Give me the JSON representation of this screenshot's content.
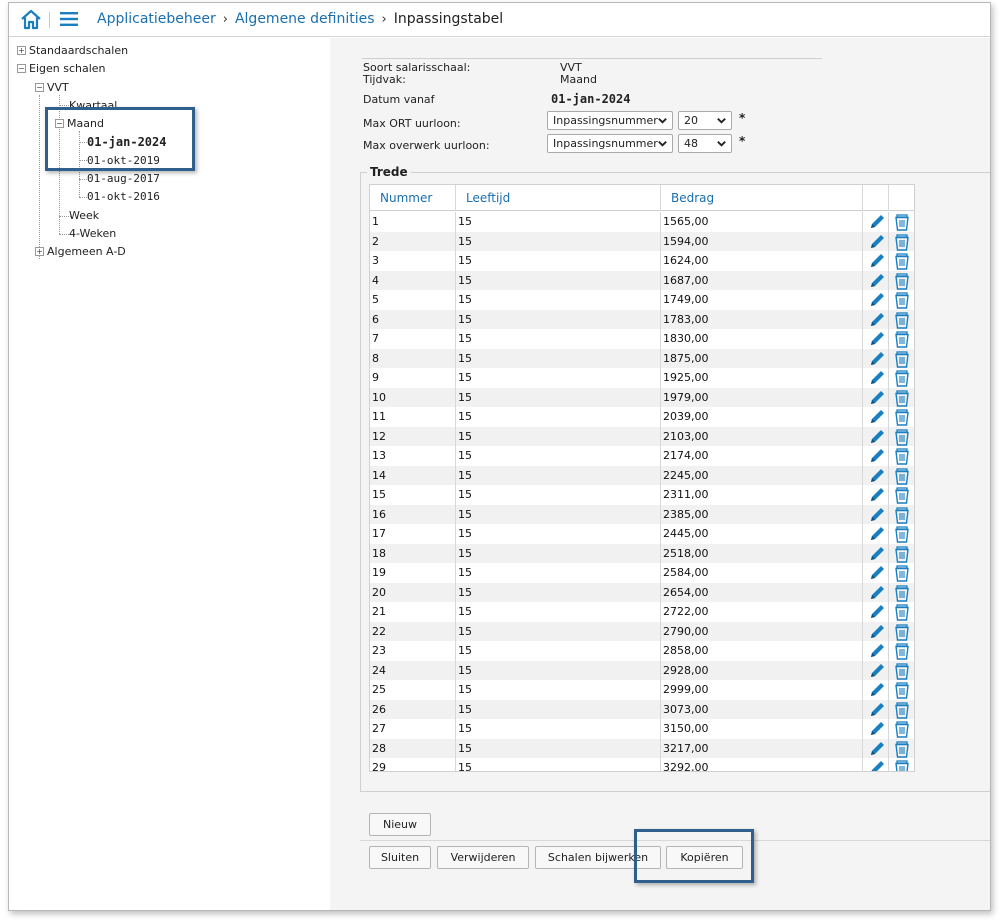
{
  "topbar": {
    "home_icon": "home-icon",
    "menu_icon": "hamburger-menu-icon",
    "breadcrumb": [
      {
        "label": "Applicatiebeheer",
        "link": true
      },
      {
        "label": "Algemene definities",
        "link": true
      },
      {
        "label": "Inpassingstabel",
        "link": false
      }
    ],
    "separator": "›"
  },
  "tree": {
    "standaardschalen": "Standaardschalen",
    "eigen_schalen": "Eigen schalen",
    "vvt": "VVT",
    "kwartaal": "Kwartaal",
    "maand": "Maand",
    "dates": [
      "01-jan-2024",
      "01-okt-2019",
      "01-aug-2017",
      "01-okt-2016"
    ],
    "week": "Week",
    "vier_weken": "4-Weken",
    "algemeen": "Algemeen A-D",
    "expand_plus": "+",
    "collapse_minus": "−"
  },
  "form": {
    "soort_label": "Soort salarisschaal:",
    "soort_value": "VVT",
    "tijdvak_label": "Tijdvak:",
    "tijdvak_value": "Maand",
    "datum_label": "Datum vanaf",
    "datum_value": "01-jan-2024",
    "max_ort_label": "Max ORT uurloon:",
    "max_ort_type": "Inpassingsnummer",
    "max_ort_num": "20",
    "max_overwerk_label": "Max overwerk uurloon:",
    "max_overwerk_type": "Inpassingsnummer",
    "max_overwerk_num": "48",
    "asterisk": "*"
  },
  "trede": {
    "legend": "Trede",
    "columns": [
      "Nummer",
      "Leeftijd",
      "Bedrag"
    ],
    "rows": [
      [
        "1",
        "15",
        "1565,00"
      ],
      [
        "2",
        "15",
        "1594,00"
      ],
      [
        "3",
        "15",
        "1624,00"
      ],
      [
        "4",
        "15",
        "1687,00"
      ],
      [
        "5",
        "15",
        "1749,00"
      ],
      [
        "6",
        "15",
        "1783,00"
      ],
      [
        "7",
        "15",
        "1830,00"
      ],
      [
        "8",
        "15",
        "1875,00"
      ],
      [
        "9",
        "15",
        "1925,00"
      ],
      [
        "10",
        "15",
        "1979,00"
      ],
      [
        "11",
        "15",
        "2039,00"
      ],
      [
        "12",
        "15",
        "2103,00"
      ],
      [
        "13",
        "15",
        "2174,00"
      ],
      [
        "14",
        "15",
        "2245,00"
      ],
      [
        "15",
        "15",
        "2311,00"
      ],
      [
        "16",
        "15",
        "2385,00"
      ],
      [
        "17",
        "15",
        "2445,00"
      ],
      [
        "18",
        "15",
        "2518,00"
      ],
      [
        "19",
        "15",
        "2584,00"
      ],
      [
        "20",
        "15",
        "2654,00"
      ],
      [
        "21",
        "15",
        "2722,00"
      ],
      [
        "22",
        "15",
        "2790,00"
      ],
      [
        "23",
        "15",
        "2858,00"
      ],
      [
        "24",
        "15",
        "2928,00"
      ],
      [
        "25",
        "15",
        "2999,00"
      ],
      [
        "26",
        "15",
        "3073,00"
      ],
      [
        "27",
        "15",
        "3150,00"
      ],
      [
        "28",
        "15",
        "3217,00"
      ],
      [
        "29",
        "15",
        "3292,00"
      ]
    ],
    "row_icons": [
      "pencil-edit-icon",
      "trash-delete-icon"
    ]
  },
  "buttons": {
    "nieuw": "Nieuw",
    "sluiten": "Sluiten",
    "verwijderen": "Verwijderen",
    "schalen_bijwerken": "Schalen bijwerken",
    "kopieren": "Kopiëren"
  },
  "colors": {
    "link_blue": "#1a6fb0",
    "highlight_border": "#2f5f8a",
    "icon_blue": "#1a7fc1"
  }
}
